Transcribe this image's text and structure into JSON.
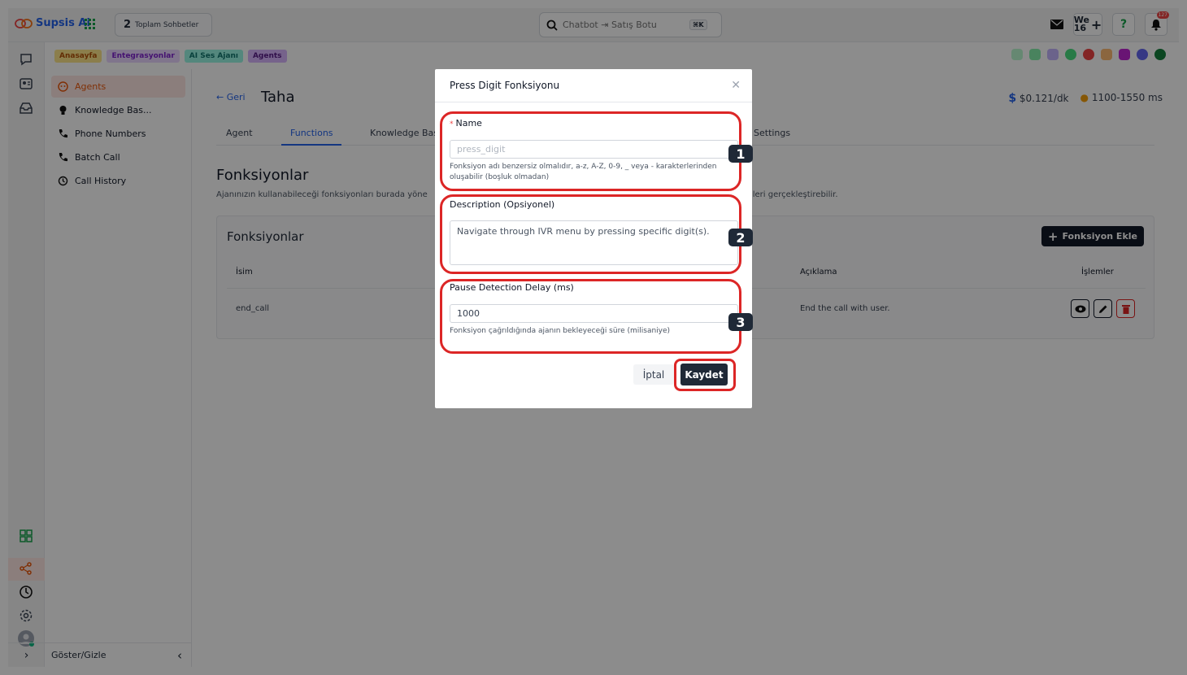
{
  "topbar": {
    "brand": "Supsis Ai",
    "conversation_count": "2",
    "conversation_label": "Toplam Sohbetler",
    "search_placeholder": "Chatbot ⇥ Satış Botu",
    "search_shortcut": "⌘K",
    "date_label": "We",
    "date_day": "16",
    "notification_count": "127"
  },
  "breadcrumb": [
    "Anasayfa",
    "Entegrasyonlar",
    "AI Ses Ajanı",
    "Agents"
  ],
  "sidebar": {
    "items": [
      {
        "label": "Agents",
        "icon": "robot-icon"
      },
      {
        "label": "Knowledge Bas...",
        "icon": "lightbulb-icon"
      },
      {
        "label": "Phone Numbers",
        "icon": "phone-icon"
      },
      {
        "label": "Batch Call",
        "icon": "phone-icon"
      },
      {
        "label": "Call History",
        "icon": "history-icon"
      }
    ],
    "footer_label": "Göster/Gizle"
  },
  "page": {
    "back_label": "Geri",
    "title": "Taha",
    "price": "$0.121/dk",
    "latency": "1100-1550 ms",
    "tabs": [
      "Agent",
      "Functions",
      "Knowledge Bas",
      "Settings"
    ],
    "section_title": "Fonksiyonlar",
    "section_desc_left": "Ajanınızın kullanabileceği fonksiyonları burada yöne",
    "section_desc_right": "mleri gerçekleştirebilir."
  },
  "functions_card": {
    "title": "Fonksiyonlar",
    "add_button": "Fonksiyon Ekle",
    "columns": [
      "İsim",
      "Açıklama",
      "İşlemler"
    ],
    "rows": [
      {
        "name": "end_call",
        "description": "End the call with user."
      }
    ]
  },
  "modal": {
    "title": "Press Digit Fonksiyonu",
    "name_label": "Name",
    "name_placeholder": "press_digit",
    "name_help": "Fonksiyon adı benzersiz olmalıdır, a-z, A-Z, 0-9, _ veya - karakterlerinden oluşabilir (boşluk olmadan)",
    "description_label": "Description (Opsiyonel)",
    "description_value": "Navigate through IVR menu by pressing specific digit(s).",
    "delay_label": "Pause Detection Delay (ms)",
    "delay_value": "1000",
    "delay_help": "Fonksiyon çağrıldığında ajanın bekleyeceği süre (milisaniye)",
    "cancel_label": "İptal",
    "save_label": "Kaydet"
  },
  "annotations": [
    "1",
    "2",
    "3"
  ],
  "colors": {
    "accent": "#2563eb",
    "highlight": "#dc2626",
    "active_nav": "#ea580c"
  }
}
